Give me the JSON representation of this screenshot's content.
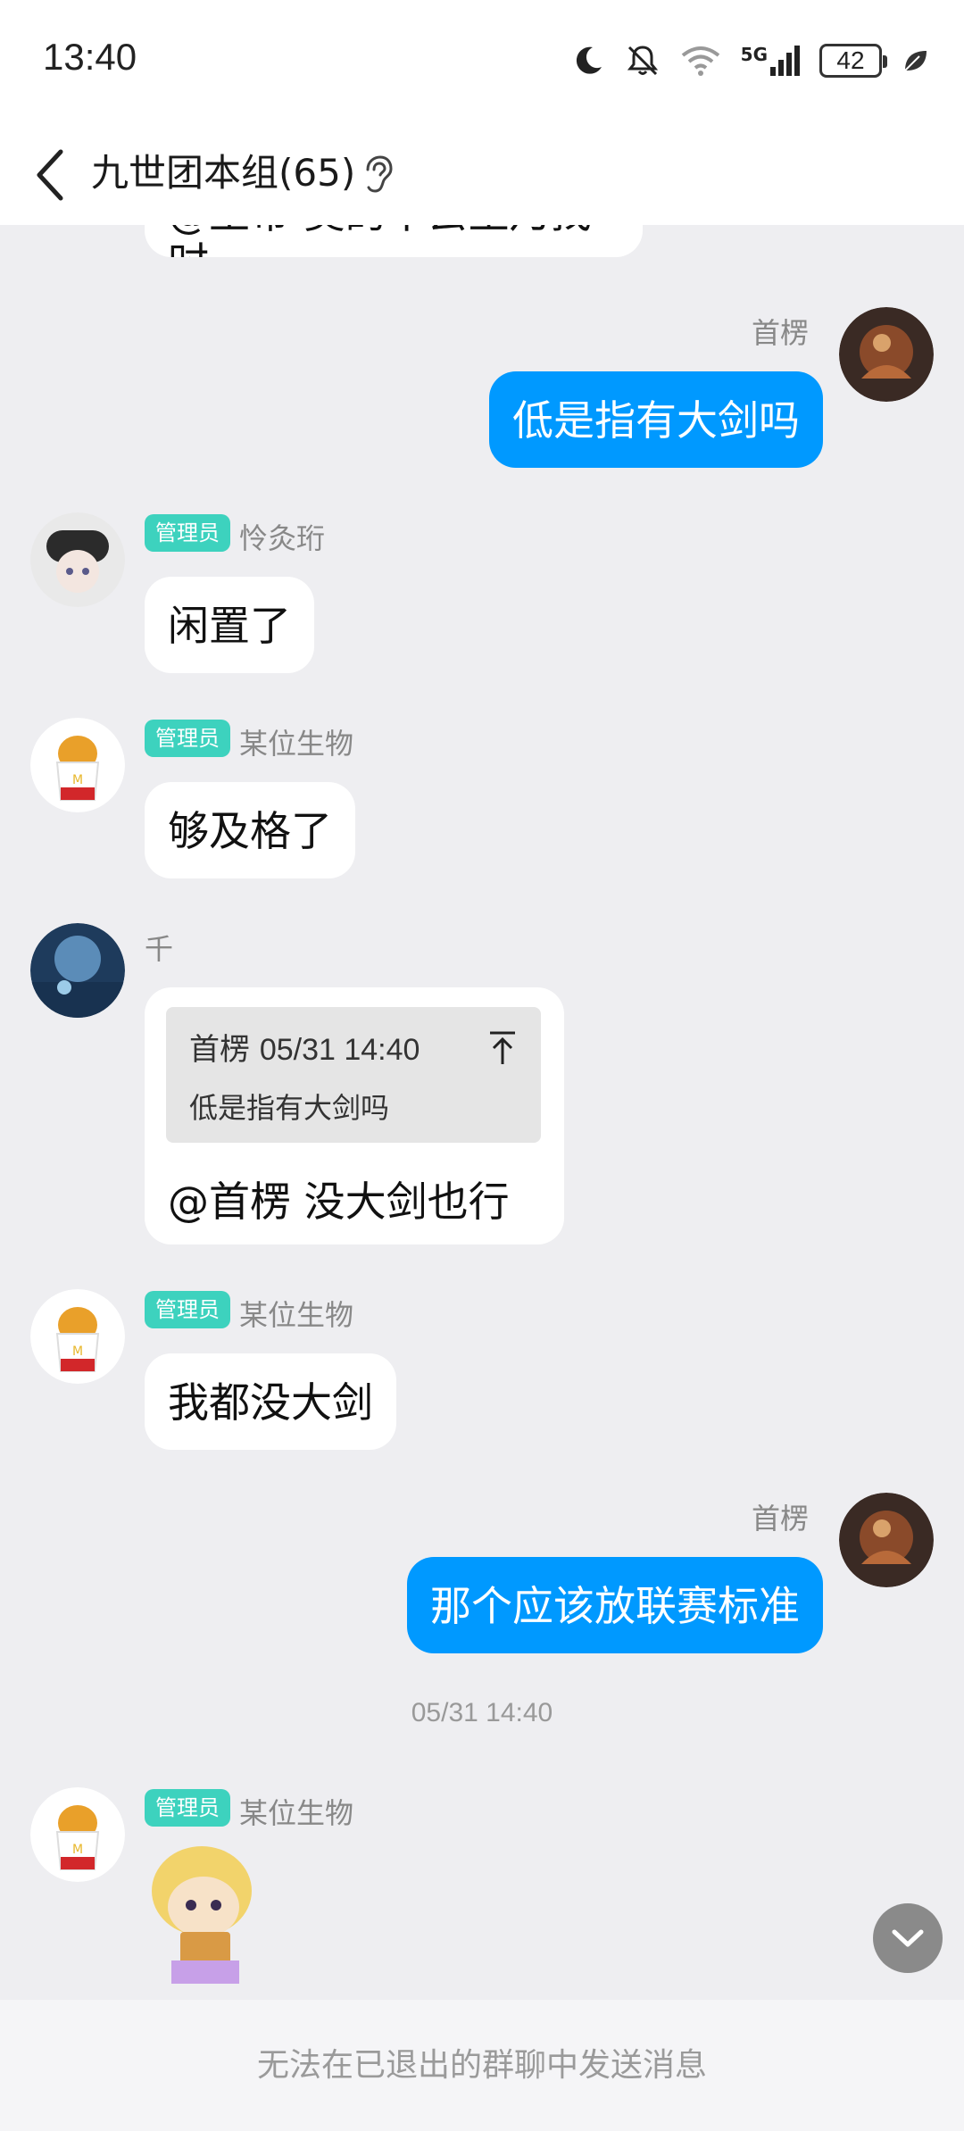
{
  "status_bar": {
    "time": "13:40",
    "network_label": "5G",
    "battery": "42"
  },
  "header": {
    "title": "九世团本组(65)"
  },
  "messages": [
    {
      "side": "left",
      "text": "@王帝 莫的不去王乃找时"
    },
    {
      "side": "right",
      "sender": "首楞",
      "text": "低是指有大剑吗"
    },
    {
      "side": "left",
      "role": "管理员",
      "sender": "怜灸珩",
      "text": "闲置了"
    },
    {
      "side": "left",
      "role": "管理员",
      "sender": "某位生物",
      "text": "够及格了"
    },
    {
      "side": "left",
      "sender": "千",
      "quote": {
        "author": "首楞",
        "time": "05/31 14:40",
        "text": "低是指有大剑吗"
      },
      "text": "@首楞 没大剑也行"
    },
    {
      "side": "left",
      "role": "管理员",
      "sender": "某位生物",
      "text": "我都没大剑"
    },
    {
      "side": "right",
      "sender": "首楞",
      "text": "那个应该放联赛标准"
    },
    {
      "type": "timestamp",
      "text": "05/31 14:40"
    },
    {
      "side": "left",
      "role": "管理员",
      "sender": "某位生物",
      "type": "sticker"
    }
  ],
  "footer": {
    "notice": "无法在已退出的群聊中发送消息"
  },
  "icons": [
    "back-icon",
    "ear-icon",
    "moon-icon",
    "mute-icon",
    "wifi-icon",
    "signal-icon",
    "battery-icon",
    "leaf-icon",
    "scroll-down-icon",
    "quote-up-icon"
  ],
  "colors": {
    "accent": "#0099FF",
    "admin_badge": "#3DD2BE",
    "background": "#EEEEF1"
  }
}
